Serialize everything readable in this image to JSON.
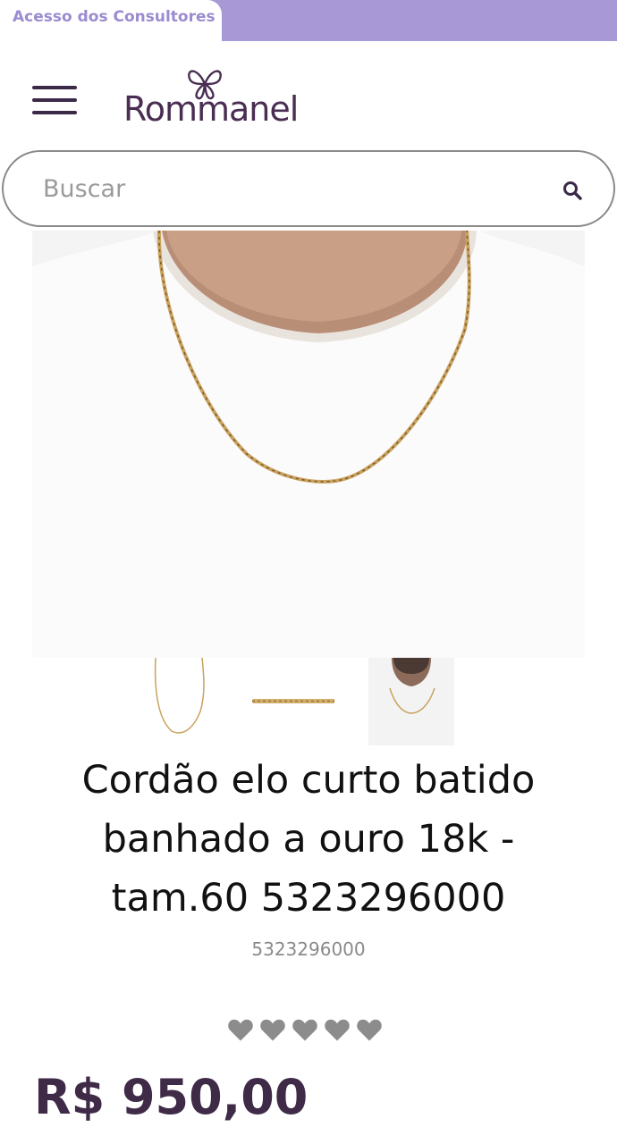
{
  "top_bar": {
    "consultant_link": "Acesso dos Consultores",
    "accent_color": "#a998d6"
  },
  "header": {
    "menu_icon": "hamburger-menu-icon",
    "logo_text": "Rommanel",
    "logo_icon": "butterfly-logo-icon"
  },
  "search": {
    "placeholder": "Buscar",
    "value": "",
    "icon": "search-icon"
  },
  "product": {
    "main_image": "man-wearing-gold-chain-photo",
    "thumbnails": [
      "chain-full-view",
      "chain-detail-view",
      "chain-on-model-view"
    ],
    "title": "Cordão elo curto batido banhado a ouro 18k - tam.60 5323296000",
    "sku": "5323296000",
    "rating": {
      "stars": 0,
      "max": 5,
      "icon": "heart-icon"
    },
    "price": "R$ 950,00",
    "price_color": "#3f2b48"
  }
}
